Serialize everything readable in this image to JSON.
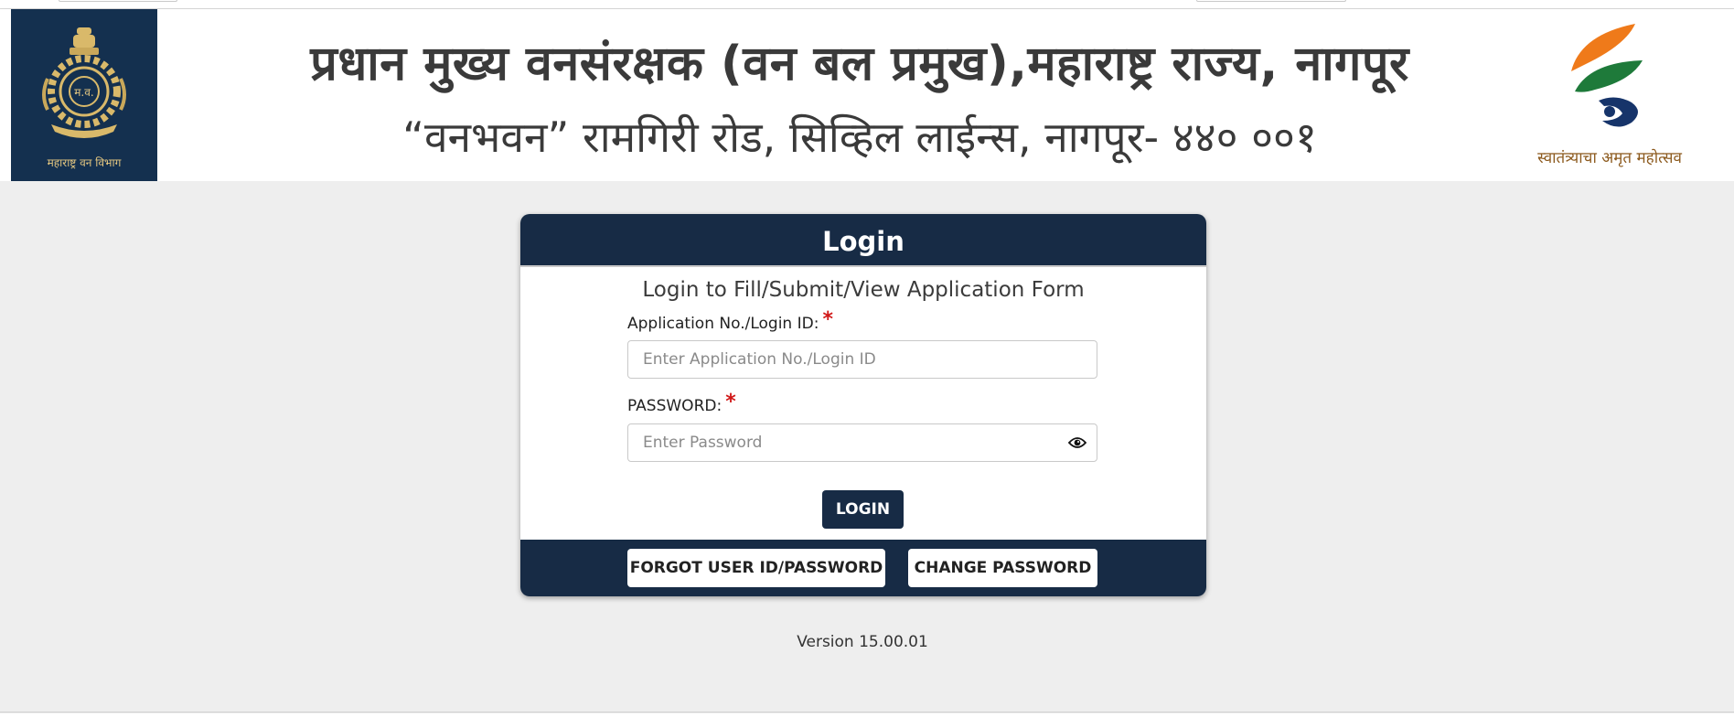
{
  "banner": {
    "title": "प्रधान मुख्य वनसंरक्षक (वन बल प्रमुख),महाराष्ट्र राज्य, नागपूर",
    "subtitle": "“वनभवन” रामगिरी रोड, सिव्हिल लाईन्स, नागपूर- ४४० ००१",
    "left_logo_caption": "महाराष्ट्र वन विभाग",
    "right_logo_caption": "स्वातंत्र्याचा अमृत महोत्सव"
  },
  "login_card": {
    "header": "Login",
    "subtitle": "Login to Fill/Submit/View Application Form",
    "login_id_label": "Application No./Login ID:",
    "login_id_placeholder": "Enter Application No./Login ID",
    "login_id_value": "",
    "password_label": "PASSWORD:",
    "password_placeholder": "Enter Password",
    "password_value": "",
    "required_marker": "*",
    "login_button": "LOGIN",
    "forgot_button": "FORGOT USER ID/PASSWORD",
    "change_password_button": "CHANGE PASSWORD"
  },
  "footer": {
    "version": "Version 15.00.01"
  },
  "icons": {
    "password_toggle": "eye-icon",
    "left_logo": "emblem-icon",
    "right_logo": "amrit-mahotsav-icon"
  },
  "colors": {
    "header_navy": "#172b45",
    "emblem_bg": "#14304f",
    "required_red": "#d11818",
    "content_bg": "#eeeeee"
  }
}
